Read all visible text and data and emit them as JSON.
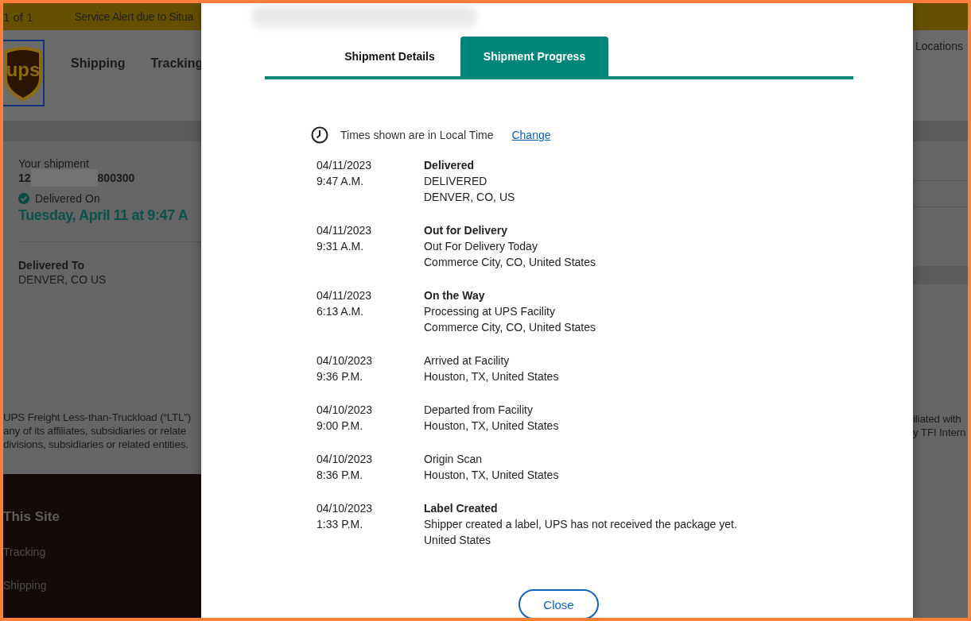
{
  "background": {
    "alert_bar": {
      "counter": "1 of 1",
      "message": "Service Alert due to Situa"
    },
    "logo_text": "ups",
    "nav": {
      "items": [
        "Shipping",
        "Tracking"
      ],
      "right_link": "Locations"
    },
    "shipment": {
      "label": "Your shipment",
      "number_start": "12",
      "number_end": "800300",
      "status": "Delivered On",
      "date": "Tuesday, April 11 at 9:47 A",
      "delivered_to_label": "Delivered To",
      "delivered_to": "DENVER, CO US"
    },
    "disclaimer_left": [
      "UPS Freight Less-than-Truckload (“LTL”)",
      "any of its affiliates, subsidiaries or relate",
      "divisions, subsidiaries or related entities."
    ],
    "disclaimer_right": [
      "iliated with",
      "y TFI Intern"
    ],
    "footer": {
      "heading": "This Site",
      "links": [
        "Tracking",
        "Shipping"
      ]
    }
  },
  "modal": {
    "tabs": [
      {
        "label": "Shipment Details",
        "selected": false
      },
      {
        "label": "Shipment Progress",
        "selected": true
      }
    ],
    "time_note": "Times shown are in Local Time",
    "change_link": "Change",
    "events": [
      {
        "kind": "milestone",
        "date": "04/11/2023",
        "time": "9:47 A.M.",
        "lines": [
          "Delivered",
          "DELIVERED",
          "DENVER, CO, US"
        ]
      },
      {
        "kind": "milestone",
        "date": "04/11/2023",
        "time": "9:31 A.M.",
        "lines": [
          "Out for Delivery",
          "Out For Delivery Today",
          "Commerce City, CO, United States"
        ]
      },
      {
        "kind": "milestone",
        "date": "04/11/2023",
        "time": "6:13 A.M.",
        "lines": [
          "On the Way",
          "Processing at UPS Facility",
          "Commerce City, CO, United States"
        ]
      },
      {
        "kind": "scan",
        "date": "04/10/2023",
        "time": "9:36 P.M.",
        "lines": [
          "Arrived at Facility",
          "Houston, TX, United States"
        ]
      },
      {
        "kind": "scan",
        "date": "04/10/2023",
        "time": "9:00 P.M.",
        "lines": [
          "Departed from Facility",
          "Houston, TX, United States"
        ]
      },
      {
        "kind": "scan",
        "date": "04/10/2023",
        "time": "8:36 P.M.",
        "lines": [
          "Origin Scan",
          "Houston, TX, United States"
        ]
      },
      {
        "kind": "milestone",
        "date": "04/10/2023",
        "time": "1:33 P.M.",
        "lines": [
          "Label Created",
          "Shipper created a label, UPS has not received the package yet.",
          "United States"
        ]
      }
    ],
    "close_button": "Close"
  }
}
